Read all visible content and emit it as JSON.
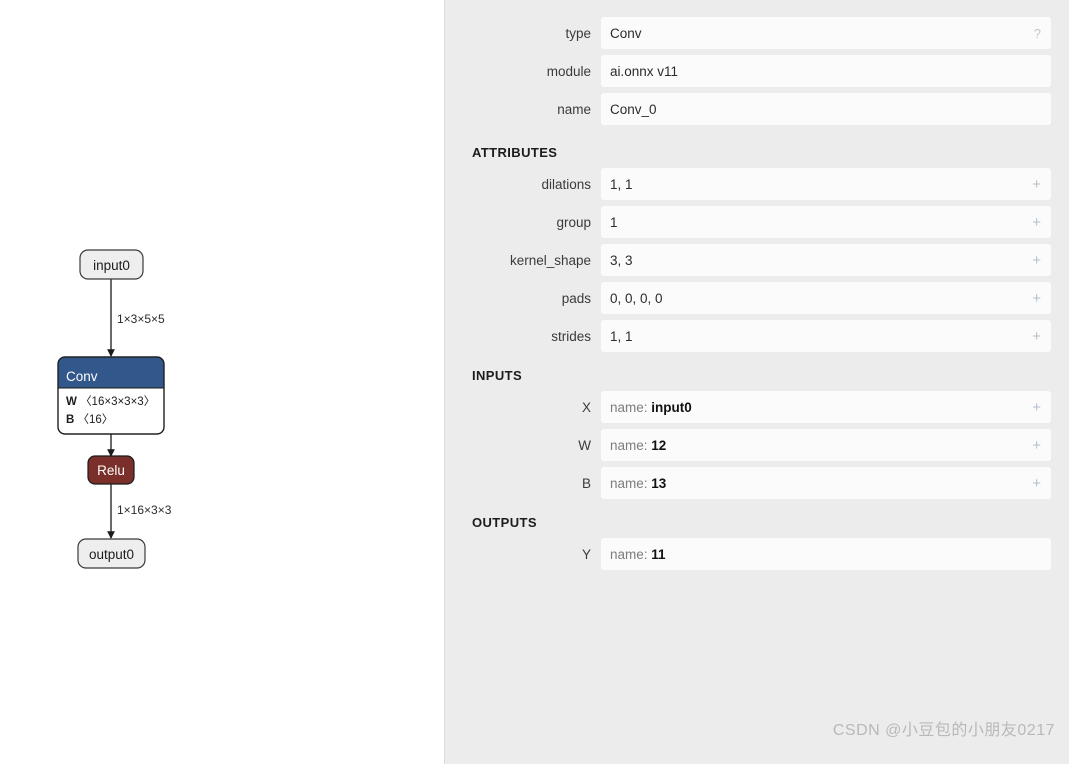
{
  "graph": {
    "nodes": [
      {
        "id": "input0",
        "kind": "io",
        "label": "input0"
      },
      {
        "id": "conv",
        "kind": "op",
        "label": "Conv",
        "color": "#31578b",
        "initializers": [
          {
            "key": "W",
            "shape": "〈16×3×3×3〉"
          },
          {
            "key": "B",
            "shape": "〈16〉"
          }
        ]
      },
      {
        "id": "relu",
        "kind": "op",
        "label": "Relu",
        "color": "#7a2f2a"
      },
      {
        "id": "output0",
        "kind": "io",
        "label": "output0"
      }
    ],
    "edges": [
      {
        "from": "input0",
        "to": "conv",
        "label": "1×3×5×5"
      },
      {
        "from": "conv",
        "to": "relu",
        "label": ""
      },
      {
        "from": "relu",
        "to": "output0",
        "label": "1×16×3×3"
      }
    ],
    "colors": {
      "io_fill": "#eeeeee",
      "io_stroke": "#3a3a3a",
      "op_body_fill": "#ffffff",
      "op_stroke": "#1a1a1a",
      "edge": "#1a1a1a",
      "edge_label": "#2b2b2b"
    }
  },
  "sidebar": {
    "node_properties": [
      {
        "label": "type",
        "value": "Conv",
        "accessory": "help"
      },
      {
        "label": "module",
        "value": "ai.onnx v11",
        "accessory": "none"
      },
      {
        "label": "name",
        "value": "Conv_0",
        "accessory": "none"
      }
    ],
    "attributes_header": "ATTRIBUTES",
    "attributes": [
      {
        "label": "dilations",
        "value": "1, 1",
        "accessory": "plus"
      },
      {
        "label": "group",
        "value": "1",
        "accessory": "plus"
      },
      {
        "label": "kernel_shape",
        "value": "3, 3",
        "accessory": "plus"
      },
      {
        "label": "pads",
        "value": "0, 0, 0, 0",
        "accessory": "plus"
      },
      {
        "label": "strides",
        "value": "1, 1",
        "accessory": "plus"
      }
    ],
    "inputs_header": "INPUTS",
    "inputs": [
      {
        "label": "X",
        "name_prefix": "name:",
        "name_value": "input0",
        "accessory": "plus"
      },
      {
        "label": "W",
        "name_prefix": "name:",
        "name_value": "12",
        "accessory": "plus"
      },
      {
        "label": "B",
        "name_prefix": "name:",
        "name_value": "13",
        "accessory": "plus"
      }
    ],
    "outputs_header": "OUTPUTS",
    "outputs": [
      {
        "label": "Y",
        "name_prefix": "name:",
        "name_value": "11",
        "accessory": "none"
      }
    ],
    "icons": {
      "help": "?",
      "plus": "+"
    }
  },
  "watermark": {
    "text": "CSDN @小豆包的小朋友0217"
  }
}
